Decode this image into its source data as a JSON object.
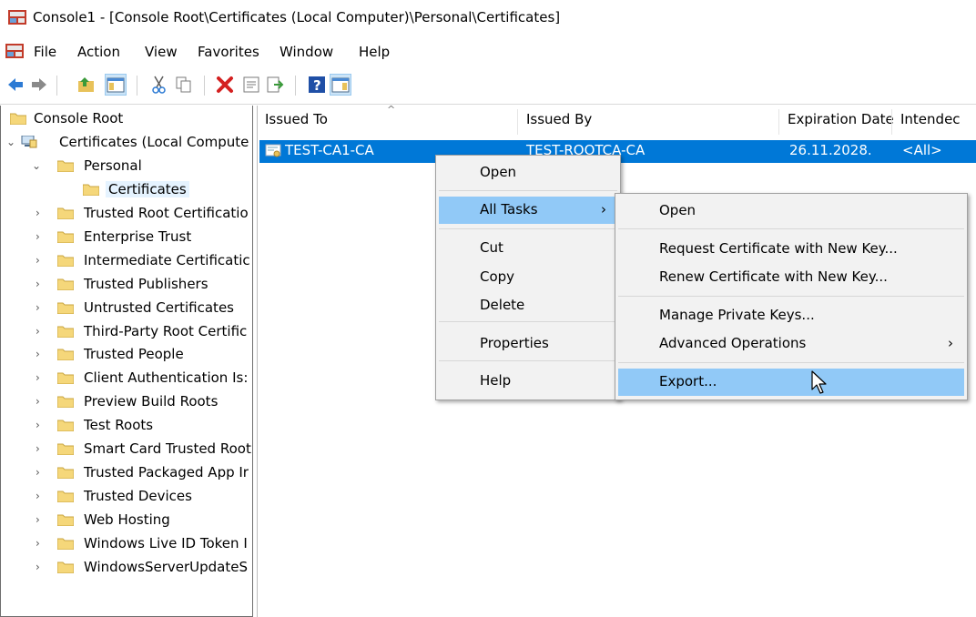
{
  "window": {
    "title": "Console1 - [Console Root\\Certificates (Local Computer)\\Personal\\Certificates]",
    "icon": "mmc-console-icon"
  },
  "menubar": {
    "items": [
      "File",
      "Action",
      "View",
      "Favorites",
      "Window",
      "Help"
    ]
  },
  "toolbar": {
    "buttons": [
      "back-icon",
      "forward-icon",
      "up-folder-icon",
      "show-hide-tree-icon",
      "cut-icon",
      "copy-icon",
      "delete-icon",
      "properties-icon",
      "export-list-icon",
      "help-icon",
      "action-pane-icon"
    ]
  },
  "tree": {
    "root": "Console Root",
    "certs": "Certificates (Local Compute",
    "personal": "Personal",
    "personal_certs": "Certificates",
    "stores": [
      "Trusted Root Certificatio",
      "Enterprise Trust",
      "Intermediate Certificatic",
      "Trusted Publishers",
      "Untrusted Certificates",
      "Third-Party Root Certific",
      "Trusted People",
      "Client Authentication Is:",
      "Preview Build Roots",
      "Test Roots",
      "Smart Card Trusted Root",
      "Trusted Packaged App Ir",
      "Trusted Devices",
      "Web Hosting",
      "Windows Live ID Token I",
      "WindowsServerUpdateS"
    ]
  },
  "list": {
    "columns": [
      "Issued To",
      "Issued By",
      "Expiration Date",
      "Intendec"
    ],
    "rows": [
      {
        "issued_to": "TEST-CA1-CA",
        "issued_by": "TEST-ROOTCA-CA",
        "expiration": "26.11.2028.",
        "intended": "<All>"
      }
    ]
  },
  "context_menu": {
    "open": "Open",
    "all_tasks": "All Tasks",
    "cut": "Cut",
    "copy": "Copy",
    "delete": "Delete",
    "properties": "Properties",
    "help": "Help"
  },
  "submenu": {
    "open": "Open",
    "request": "Request Certificate with New Key...",
    "renew": "Renew Certificate with New Key...",
    "manage": "Manage Private Keys...",
    "advanced": "Advanced Operations",
    "export": "Export..."
  },
  "colors": {
    "selection": "#0078d7",
    "menu_highlight": "#91c9f7",
    "folder": "#f5d77a"
  }
}
